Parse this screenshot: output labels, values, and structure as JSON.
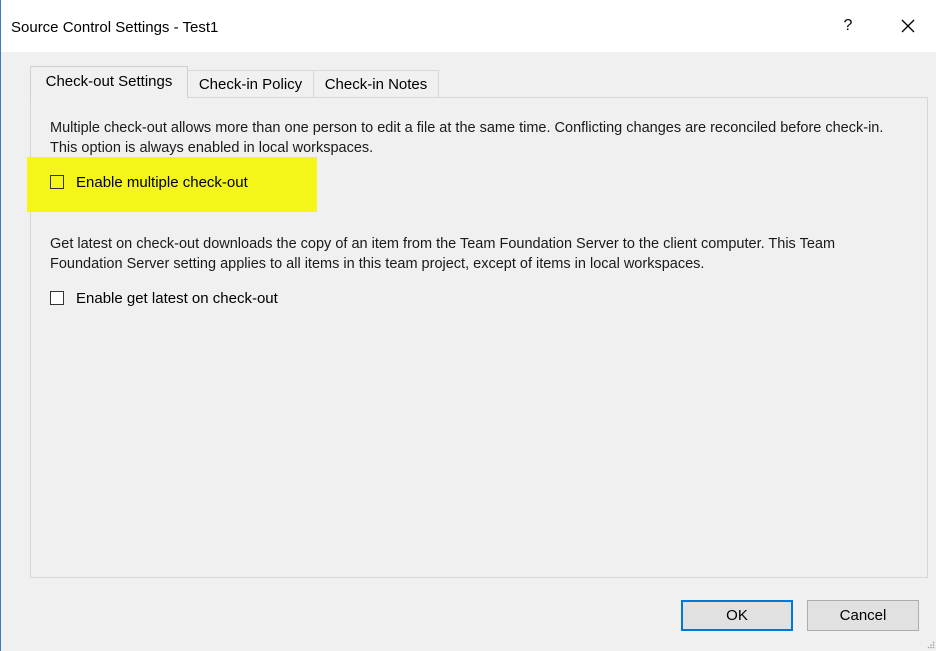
{
  "window": {
    "title": "Source Control Settings - Test1",
    "help_label": "?",
    "close_icon": "close-icon"
  },
  "tabs": [
    {
      "label": "Check-out Settings",
      "active": true
    },
    {
      "label": "Check-in Policy",
      "active": false
    },
    {
      "label": "Check-in Notes",
      "active": false
    }
  ],
  "checkout": {
    "multiple_desc": "Multiple check-out allows more than one person to edit a file at the same time. Conflicting changes are reconciled before check-in. This option is always enabled in local workspaces.",
    "multiple_label": "Enable multiple check-out",
    "multiple_checked": false,
    "getlatest_desc": "Get latest on check-out downloads the copy of an item from the Team Foundation Server to the client computer. This Team Foundation Server setting applies to all items in this team project, except of items in local workspaces.",
    "getlatest_label": "Enable get latest on check-out",
    "getlatest_checked": false
  },
  "buttons": {
    "ok_label": "OK",
    "cancel_label": "Cancel"
  },
  "colors": {
    "highlight": "#f4f61a",
    "accent": "#0078d7",
    "window_border": "#3c7ac7"
  }
}
